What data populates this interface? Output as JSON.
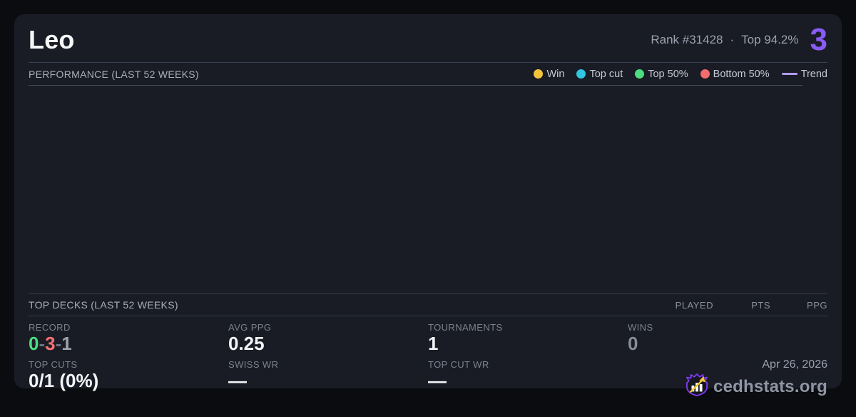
{
  "header": {
    "title": "Leo",
    "rank_text": "Rank #31428",
    "separator": "·",
    "top_percent": "Top 94.2%",
    "big_number": "3",
    "big_number_color": "#8a5cf6"
  },
  "performance": {
    "section_title": "PERFORMANCE (LAST 52 WEEKS)",
    "legend": [
      {
        "label": "Win",
        "marker": "dot",
        "color": "#f2c53d"
      },
      {
        "label": "Top cut",
        "marker": "dot",
        "color": "#2fc6e2"
      },
      {
        "label": "Top 50%",
        "marker": "dot",
        "color": "#4ade80"
      },
      {
        "label": "Bottom 50%",
        "marker": "dot",
        "color": "#f26d6d"
      },
      {
        "label": "Trend",
        "marker": "line",
        "color": "#b29af5"
      }
    ],
    "chart_points": []
  },
  "top_decks": {
    "section_title": "TOP DECKS (LAST 52 WEEKS)",
    "columns": [
      "PLAYED",
      "PTS",
      "PPG"
    ],
    "rows": []
  },
  "stats": {
    "record": {
      "label": "RECORD",
      "wins": "0",
      "losses": "3",
      "draws": "1",
      "sep": "-",
      "wins_color": "#4ade80",
      "losses_color": "#f47174",
      "draws_color": "#9ca3af"
    },
    "avg_ppg": {
      "label": "AVG PPG",
      "value": "0.25"
    },
    "tournaments": {
      "label": "TOURNAMENTS",
      "value": "1"
    },
    "wins": {
      "label": "WINS",
      "value": "0"
    },
    "top_cuts": {
      "label": "TOP CUTS",
      "value": "0/1 (0%)"
    },
    "swiss_wr": {
      "label": "SWISS WR",
      "value": "—"
    },
    "top_cut_wr": {
      "label": "TOP CUT WR",
      "value": "—"
    }
  },
  "footer": {
    "date": "Apr 26, 2026",
    "brand": "cedhstats.org",
    "logo": "shield-chart-arrow-icon",
    "logo_colors": {
      "shield": "#7c3aed",
      "bars": "#ffffff",
      "arrow": "#f0c437"
    }
  },
  "colors": {
    "page_bg": "#0b0c10",
    "card_bg": "#191c25",
    "divider": "#343a46",
    "accent_purple": "#8a5cf6"
  }
}
